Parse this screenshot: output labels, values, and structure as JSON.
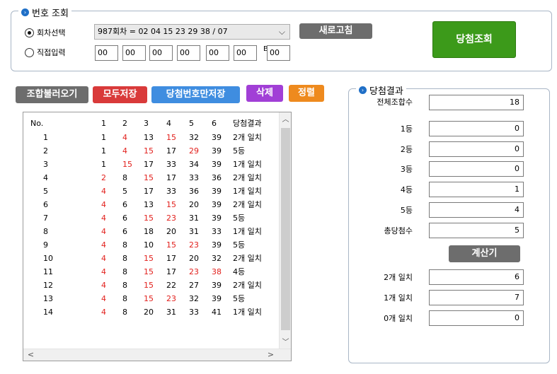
{
  "lookup": {
    "title": "번호 조회",
    "title_icon": "info-circle-icon",
    "radio_round_label": "회차선택",
    "radio_manual_label": "직접입력",
    "round_select_value": "987회차 = 02 04 15 23 29 38 / 07",
    "refresh_label": "새로고침",
    "check_label": "당첨조회",
    "manual_numbers": [
      "00",
      "00",
      "00",
      "00",
      "00",
      "00"
    ],
    "bonus_label": "B",
    "bonus_value": "00"
  },
  "toolbar": {
    "load_combos": "조합불러오기",
    "save_all": "모두저장",
    "save_winning_only": "당첨번호만저장",
    "delete": "삭제",
    "sort": "정렬"
  },
  "grid": {
    "headers": [
      "No.",
      "1",
      "2",
      "3",
      "4",
      "5",
      "6",
      "당첨결과"
    ],
    "rows": [
      {
        "no": "1",
        "nums": [
          "1",
          "4",
          "13",
          "15",
          "32",
          "39"
        ],
        "hits": [
          false,
          true,
          false,
          true,
          false,
          false
        ],
        "result": "2개 일치"
      },
      {
        "no": "2",
        "nums": [
          "1",
          "4",
          "15",
          "17",
          "29",
          "39"
        ],
        "hits": [
          false,
          true,
          true,
          false,
          true,
          false
        ],
        "result": "5등"
      },
      {
        "no": "3",
        "nums": [
          "1",
          "15",
          "17",
          "33",
          "34",
          "39"
        ],
        "hits": [
          false,
          true,
          false,
          false,
          false,
          false
        ],
        "result": "1개 일치"
      },
      {
        "no": "4",
        "nums": [
          "2",
          "8",
          "15",
          "17",
          "33",
          "36"
        ],
        "hits": [
          true,
          false,
          true,
          false,
          false,
          false
        ],
        "result": "2개 일치"
      },
      {
        "no": "5",
        "nums": [
          "4",
          "5",
          "17",
          "33",
          "36",
          "39"
        ],
        "hits": [
          true,
          false,
          false,
          false,
          false,
          false
        ],
        "result": "1개 일치"
      },
      {
        "no": "6",
        "nums": [
          "4",
          "6",
          "13",
          "15",
          "20",
          "39"
        ],
        "hits": [
          true,
          false,
          false,
          true,
          false,
          false
        ],
        "result": "2개 일치"
      },
      {
        "no": "7",
        "nums": [
          "4",
          "6",
          "15",
          "23",
          "31",
          "39"
        ],
        "hits": [
          true,
          false,
          true,
          true,
          false,
          false
        ],
        "result": "5등"
      },
      {
        "no": "8",
        "nums": [
          "4",
          "6",
          "18",
          "20",
          "31",
          "33"
        ],
        "hits": [
          true,
          false,
          false,
          false,
          false,
          false
        ],
        "result": "1개 일치"
      },
      {
        "no": "9",
        "nums": [
          "4",
          "8",
          "10",
          "15",
          "23",
          "39"
        ],
        "hits": [
          true,
          false,
          false,
          true,
          true,
          false
        ],
        "result": "5등"
      },
      {
        "no": "10",
        "nums": [
          "4",
          "8",
          "15",
          "17",
          "20",
          "32"
        ],
        "hits": [
          true,
          false,
          true,
          false,
          false,
          false
        ],
        "result": "2개 일치"
      },
      {
        "no": "11",
        "nums": [
          "4",
          "8",
          "15",
          "17",
          "23",
          "38"
        ],
        "hits": [
          true,
          false,
          true,
          false,
          true,
          true
        ],
        "result": "4등"
      },
      {
        "no": "12",
        "nums": [
          "4",
          "8",
          "15",
          "22",
          "27",
          "39"
        ],
        "hits": [
          true,
          false,
          true,
          false,
          false,
          false
        ],
        "result": "2개 일치"
      },
      {
        "no": "13",
        "nums": [
          "4",
          "8",
          "15",
          "23",
          "32",
          "39"
        ],
        "hits": [
          true,
          false,
          true,
          true,
          false,
          false
        ],
        "result": "5등"
      },
      {
        "no": "14",
        "nums": [
          "4",
          "8",
          "20",
          "31",
          "33",
          "41"
        ],
        "hits": [
          true,
          false,
          false,
          false,
          false,
          false
        ],
        "result": "1개 일치"
      }
    ],
    "scroll_up": "︿",
    "scroll_down": "﹀",
    "scroll_left": "<",
    "scroll_right": ">"
  },
  "results": {
    "title": "당첨결과",
    "title_icon": "info-circle-icon",
    "total_label": "전체조합수",
    "total_value": "18",
    "rank_rows": [
      {
        "label": "1등",
        "value": "0"
      },
      {
        "label": "2등",
        "value": "0"
      },
      {
        "label": "3등",
        "value": "0"
      },
      {
        "label": "4등",
        "value": "1"
      },
      {
        "label": "5등",
        "value": "4"
      },
      {
        "label": "총당첨수",
        "value": "5"
      }
    ],
    "calculator_label": "계산기",
    "match_rows": [
      {
        "label": "2개 일치",
        "value": "6"
      },
      {
        "label": "1개 일치",
        "value": "7"
      },
      {
        "label": "0개 일치",
        "value": "0"
      }
    ]
  },
  "colors": {
    "hit_red": "#e2201c",
    "group_border": "#a9b6c6",
    "check_green": "#3c9a1a",
    "info_blue": "#1f6fc7"
  }
}
